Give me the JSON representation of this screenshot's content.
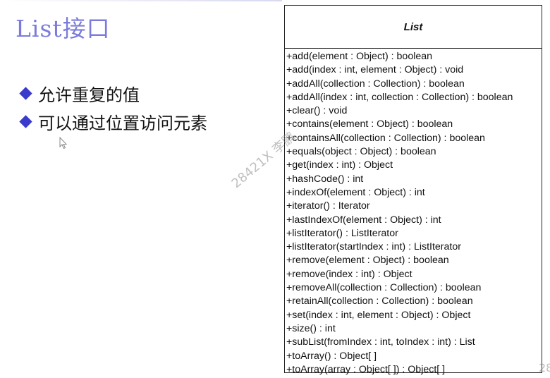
{
  "slide": {
    "title": "List接口",
    "bullets": [
      "允许重复的值",
      "可以通过位置访问元素"
    ]
  },
  "uml": {
    "class_name": "List",
    "operations": [
      "+add(element : Object) : boolean",
      "+add(index : int, element : Object) : void",
      "+addAll(collection : Collection) : boolean",
      "+addAll(index : int, collection : Collection) : boolean",
      "+clear() : void",
      "+contains(element : Object) : boolean",
      "+containsAll(collection : Collection) : boolean",
      "+equals(object : Object) : boolean",
      "+get(index : int) : Object",
      "+hashCode() : int",
      "+indexOf(element : Object) : int",
      "+iterator() : Iterator",
      "+lastIndexOf(element : Object) : int",
      "+listIterator() : ListIterator",
      "+listIterator(startIndex : int) : ListIterator",
      "+remove(element : Object) : boolean",
      "+remove(index : int) : Object",
      "+removeAll(collection : Collection) : boolean",
      "+retainAll(collection : Collection) : boolean",
      "+set(index : int, element : Object) : Object",
      "+size() : int",
      "+subList(fromIndex : int, toIndex : int) : List",
      "+toArray() : Object[ ]",
      "+toArray(array : Object[ ]) : Object[ ]"
    ]
  },
  "watermark": "28421X 李鹏",
  "corner_watermark": "28",
  "colors": {
    "title": "#7b7bdc",
    "bullet_marker": "#3a3acc"
  }
}
